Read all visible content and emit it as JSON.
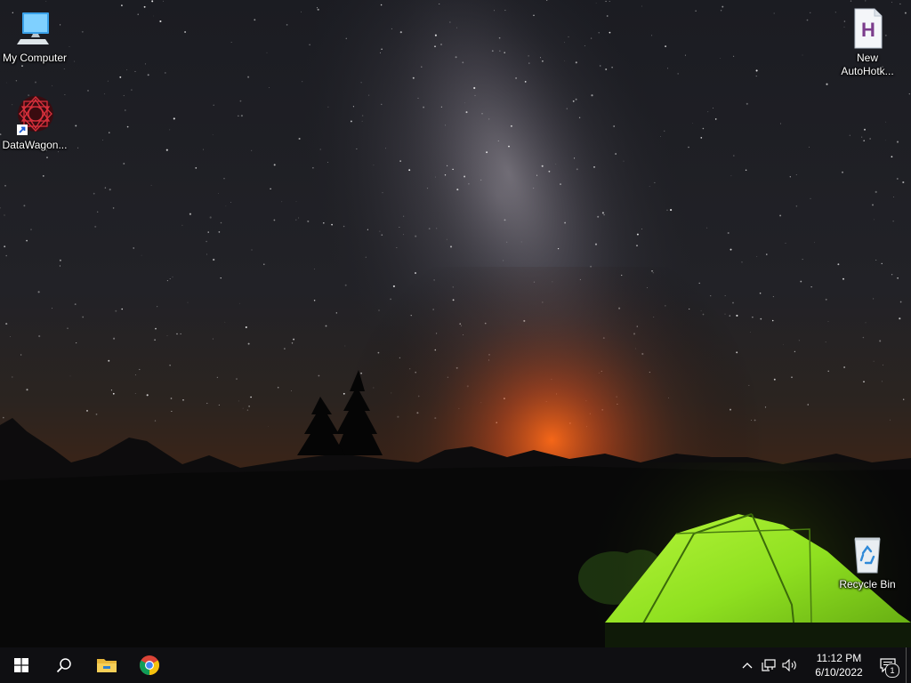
{
  "desktop": {
    "icons": [
      {
        "label": "My Computer",
        "icon": "computer-icon"
      },
      {
        "label": "DataWagon...",
        "icon": "datawagon-shortcut-icon"
      },
      {
        "label": "New AutoHotk...",
        "icon": "autohotkey-script-icon"
      },
      {
        "label": "Recycle Bin",
        "icon": "recycle-bin-icon"
      }
    ]
  },
  "taskbar": {
    "pinned": [
      {
        "name": "start",
        "icon": "windows-start-icon"
      },
      {
        "name": "search",
        "icon": "search-icon"
      },
      {
        "name": "file-explorer",
        "icon": "folder-icon"
      },
      {
        "name": "chrome",
        "icon": "chrome-icon"
      }
    ],
    "tray": {
      "icons": [
        "chevron-up-icon",
        "network-icon",
        "volume-icon"
      ],
      "time": "11:12 PM",
      "date": "6/10/2022",
      "notification_count": "1"
    }
  },
  "colors": {
    "taskbar": "#0f0f12",
    "tent": "#8fe020",
    "horizon_glow": "#e8601a"
  }
}
